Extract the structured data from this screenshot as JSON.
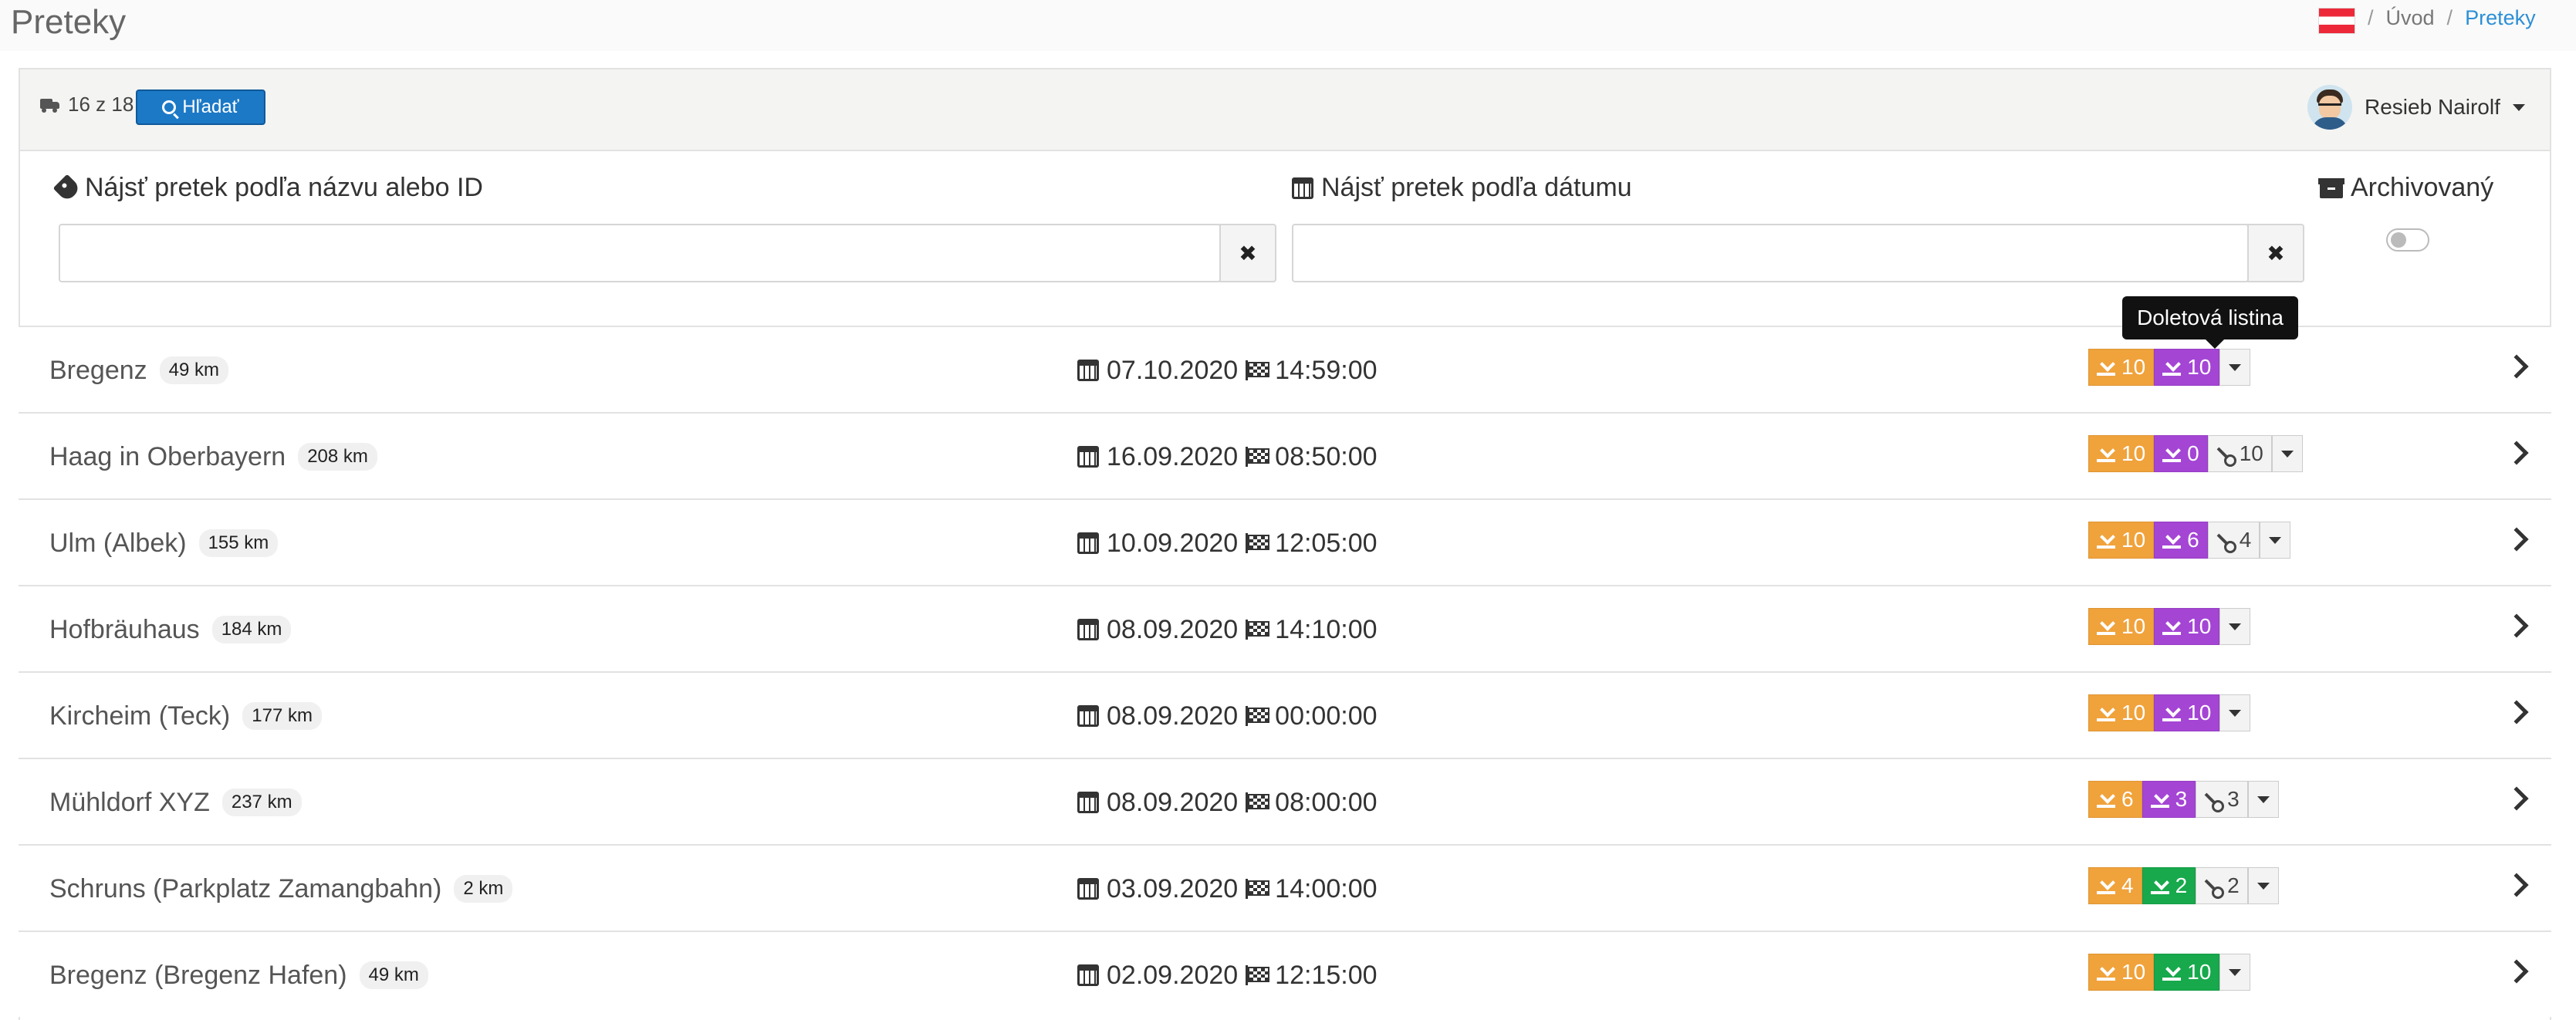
{
  "page": {
    "title": "Preteky"
  },
  "breadcrumb": {
    "sep": "/",
    "home": "Úvod",
    "current": "Preteky"
  },
  "toolbar": {
    "count": "16 z 18",
    "search_label": "Hľadať"
  },
  "user": {
    "name": "Resieb Nairolf"
  },
  "filters": {
    "name_label": "Nájsť pretek podľa názvu alebo ID",
    "name_value": "",
    "date_label": "Nájsť pretek podľa dátumu",
    "date_value": "",
    "clear_symbol": "✖",
    "archived_label": "Archivovaný"
  },
  "tooltip": "Doletová listina",
  "races": [
    {
      "name": "Bregenz",
      "km": "49 km",
      "date": "07.10.2020",
      "time": "14:59:00",
      "b1": "10",
      "b2": "10",
      "b2_color": "purple"
    },
    {
      "name": "Haag in Oberbayern",
      "km": "208 km",
      "date": "16.09.2020",
      "time": "08:50:00",
      "b1": "10",
      "b2": "0",
      "b2_color": "purple",
      "b3": "10"
    },
    {
      "name": "Ulm (Albek)",
      "km": "155 km",
      "date": "10.09.2020",
      "time": "12:05:00",
      "b1": "10",
      "b2": "6",
      "b2_color": "purple",
      "b3": "4"
    },
    {
      "name": "Hofbräuhaus",
      "km": "184 km",
      "date": "08.09.2020",
      "time": "14:10:00",
      "b1": "10",
      "b2": "10",
      "b2_color": "purple"
    },
    {
      "name": "Kircheim (Teck)",
      "km": "177 km",
      "date": "08.09.2020",
      "time": "00:00:00",
      "b1": "10",
      "b2": "10",
      "b2_color": "purple"
    },
    {
      "name": "Mühldorf XYZ",
      "km": "237 km",
      "date": "08.09.2020",
      "time": "08:00:00",
      "b1": "6",
      "b2": "3",
      "b2_color": "purple",
      "b3": "3"
    },
    {
      "name": "Schruns (Parkplatz Zamangbahn)",
      "km": "2 km",
      "date": "03.09.2020",
      "time": "14:00:00",
      "b1": "4",
      "b2": "2",
      "b2_color": "green",
      "b3": "2"
    },
    {
      "name": "Bregenz (Bregenz Hafen)",
      "km": "49 km",
      "date": "02.09.2020",
      "time": "12:15:00",
      "b1": "10",
      "b2": "10",
      "b2_color": "green"
    }
  ]
}
